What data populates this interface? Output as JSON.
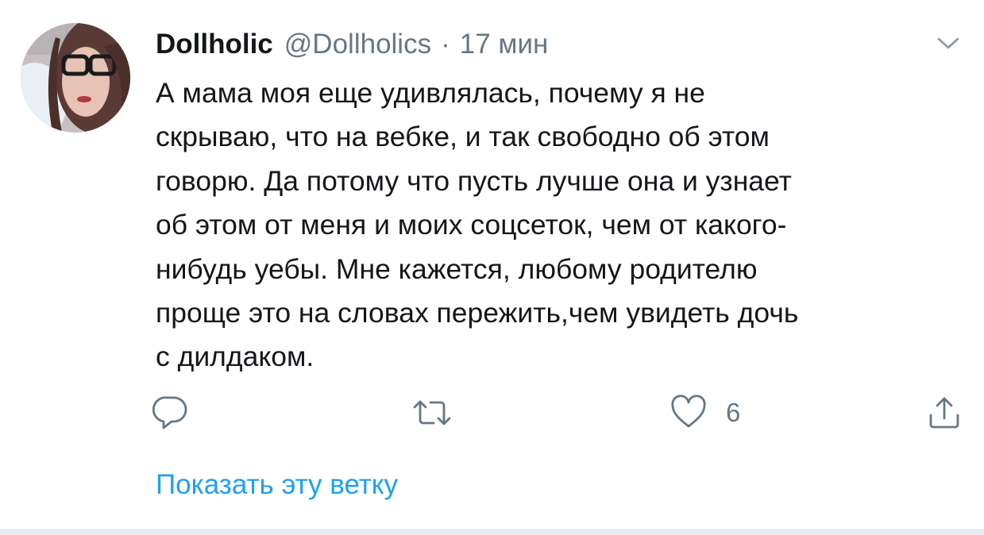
{
  "tweet": {
    "author": {
      "display_name": "Dollholic",
      "handle": "@Dollholics",
      "separator": "·",
      "time": "17 мин"
    },
    "text_lines": [
      "А мама моя еще удивлялась,  почему я не",
      "скрываю, что на вебке, и так свободно об этом",
      "говорю. Да потому что пусть лучше она и узнает",
      "об этом от меня и моих соцсеток, чем от какого-",
      "нибудь уебы. Мне кажется, любому родителю",
      "проще это на словах пережить,чем увидеть дочь",
      "с дилдаком."
    ],
    "actions": {
      "reply_icon": "reply-icon",
      "retweet_icon": "retweet-icon",
      "like_icon": "heart-icon",
      "like_count": "6",
      "share_icon": "share-icon"
    },
    "show_thread_label": "Показать эту ветку"
  },
  "colors": {
    "text": "#14171a",
    "secondary": "#657786",
    "link": "#1da1f2",
    "divider": "#e6ecf0"
  }
}
